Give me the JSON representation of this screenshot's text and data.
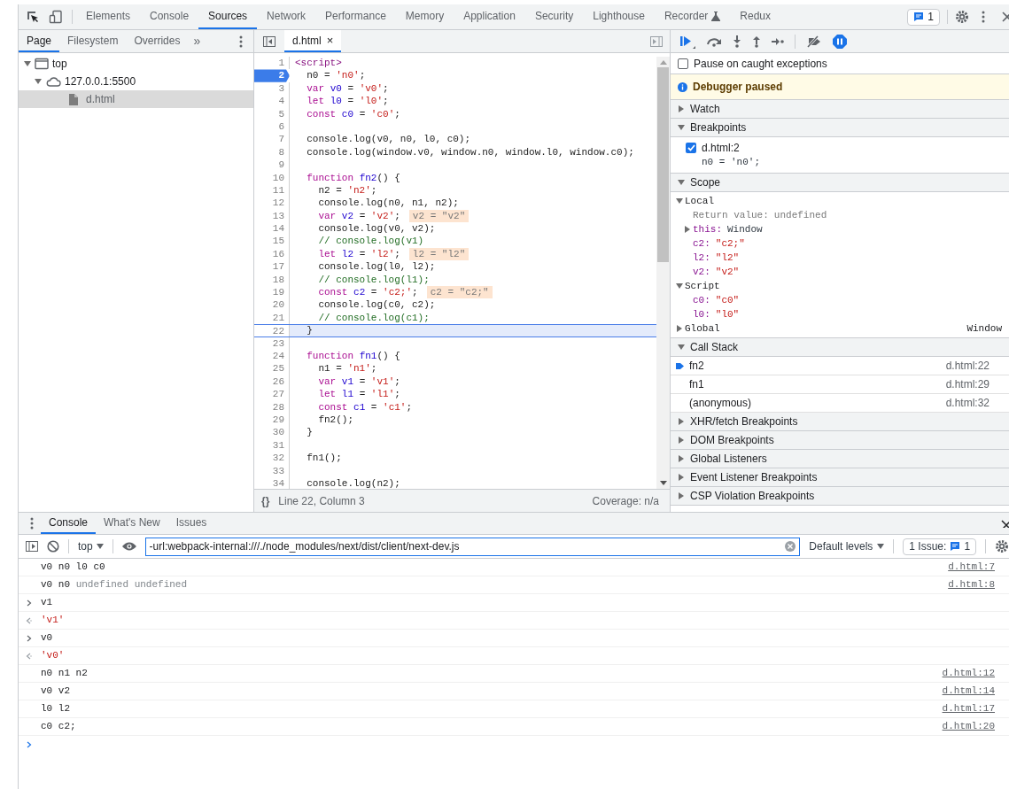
{
  "main_tabs": [
    {
      "label": "Elements",
      "selected": false
    },
    {
      "label": "Console",
      "selected": false
    },
    {
      "label": "Sources",
      "selected": true
    },
    {
      "label": "Network",
      "selected": false
    },
    {
      "label": "Performance",
      "selected": false
    },
    {
      "label": "Memory",
      "selected": false
    },
    {
      "label": "Application",
      "selected": false
    },
    {
      "label": "Security",
      "selected": false
    },
    {
      "label": "Lighthouse",
      "selected": false
    },
    {
      "label": "Recorder",
      "selected": false,
      "experimental": true
    },
    {
      "label": "Redux",
      "selected": false
    }
  ],
  "issues_badge": "1",
  "navigator": {
    "tabs": [
      {
        "label": "Page",
        "selected": true
      },
      {
        "label": "Filesystem",
        "selected": false
      },
      {
        "label": "Overrides",
        "selected": false
      }
    ],
    "more": "»",
    "tree": [
      {
        "label": "top",
        "kind": "frame",
        "expanded": true,
        "selected": false,
        "children": [
          {
            "label": "127.0.0.1:5500",
            "kind": "origin",
            "expanded": true,
            "selected": false,
            "children": [
              {
                "label": "d.html",
                "kind": "file",
                "selected": true
              }
            ]
          }
        ]
      }
    ]
  },
  "editor": {
    "tab": "d.html",
    "close": "×",
    "status": "Line 22, Column 3",
    "coverage": "Coverage: n/a",
    "pretty": "{}",
    "lines": [
      {
        "number": "1",
        "code": "<script>",
        "breakpoint": false,
        "paused": false
      },
      {
        "number": "2",
        "code": "  n0 = 'n0';",
        "breakpoint": true,
        "paused": false
      },
      {
        "number": "3",
        "code": "  var v0 = 'v0';",
        "breakpoint": false,
        "paused": false
      },
      {
        "number": "4",
        "code": "  let l0 = 'l0';",
        "breakpoint": false,
        "paused": false
      },
      {
        "number": "5",
        "code": "  const c0 = 'c0';",
        "breakpoint": false,
        "paused": false
      },
      {
        "number": "6",
        "breakpoint": false,
        "paused": false
      },
      {
        "number": "7",
        "code": "  console.log(v0, n0, l0, c0);",
        "breakpoint": false,
        "paused": false
      },
      {
        "number": "8",
        "code": "  console.log(window.v0, window.n0, window.l0, window.c0);",
        "breakpoint": false,
        "paused": false
      },
      {
        "number": "9",
        "breakpoint": false,
        "paused": false
      },
      {
        "number": "10",
        "code": "  function fn2() {",
        "breakpoint": false,
        "paused": false
      },
      {
        "number": "11",
        "code": "    n2 = 'n2';",
        "breakpoint": false,
        "paused": false
      },
      {
        "number": "12",
        "code": "    console.log(n0, n1, n2);",
        "breakpoint": false,
        "paused": false
      },
      {
        "number": "13",
        "code": "    var v2 = 'v2';",
        "breakpoint": false,
        "paused": false,
        "inline_value": "v2 = \"v2\""
      },
      {
        "number": "14",
        "code": "    console.log(v0, v2);",
        "breakpoint": false,
        "paused": false
      },
      {
        "number": "15",
        "code": "    // console.log(v1)",
        "breakpoint": false,
        "paused": false
      },
      {
        "number": "16",
        "code": "    let l2 = 'l2';",
        "breakpoint": false,
        "paused": false,
        "inline_value": "l2 = \"l2\""
      },
      {
        "number": "17",
        "code": "    console.log(l0, l2);",
        "breakpoint": false,
        "paused": false
      },
      {
        "number": "18",
        "code": "    // console.log(l1);",
        "breakpoint": false,
        "paused": false
      },
      {
        "number": "19",
        "code": "    const c2 = 'c2;';",
        "breakpoint": false,
        "paused": false,
        "inline_value": "c2 = \"c2;\""
      },
      {
        "number": "20",
        "code": "    console.log(c0, c2);",
        "breakpoint": false,
        "paused": false
      },
      {
        "number": "21",
        "code": "    // console.log(c1);",
        "breakpoint": false,
        "paused": false
      },
      {
        "number": "22",
        "code": "  }",
        "breakpoint": false,
        "paused": true
      },
      {
        "number": "23",
        "breakpoint": false,
        "paused": false
      },
      {
        "number": "24",
        "code": "  function fn1() {",
        "breakpoint": false,
        "paused": false
      },
      {
        "number": "25",
        "code": "    n1 = 'n1';",
        "breakpoint": false,
        "paused": false
      },
      {
        "number": "26",
        "code": "    var v1 = 'v1';",
        "breakpoint": false,
        "paused": false
      },
      {
        "number": "27",
        "code": "    let l1 = 'l1';",
        "breakpoint": false,
        "paused": false
      },
      {
        "number": "28",
        "code": "    const c1 = 'c1';",
        "breakpoint": false,
        "paused": false
      },
      {
        "number": "29",
        "code": "    fn2();",
        "breakpoint": false,
        "paused": false
      },
      {
        "number": "30",
        "code": "  }",
        "breakpoint": false,
        "paused": false
      },
      {
        "number": "31",
        "breakpoint": false,
        "paused": false
      },
      {
        "number": "32",
        "code": "  fn1();",
        "breakpoint": false,
        "paused": false
      },
      {
        "number": "33",
        "breakpoint": false,
        "paused": false
      },
      {
        "number": "34",
        "code": "  console.log(n2);",
        "breakpoint": false,
        "paused": false
      }
    ]
  },
  "debugger": {
    "pause_on_caught": {
      "label": "Pause on caught exceptions",
      "checked": false
    },
    "paused_message": "Debugger paused",
    "watch": {
      "title": "Watch",
      "expanded": false
    },
    "breakpoints": {
      "title": "Breakpoints",
      "expanded": true,
      "items": [
        {
          "location": "d.html:2",
          "code": "n0 = 'n0';",
          "checked": true
        }
      ]
    },
    "scope": {
      "title": "Scope",
      "expanded": true,
      "groups": [
        {
          "name": "Local",
          "expanded": true,
          "children": [
            {
              "name": "Return value:",
              "value": "undefined",
              "kind": "special"
            },
            {
              "name": "this:",
              "value": "Window",
              "kind": "object",
              "expanded": false
            },
            {
              "name": "c2:",
              "value": "\"c2;\"",
              "kind": "string"
            },
            {
              "name": "l2:",
              "value": "\"l2\"",
              "kind": "string"
            },
            {
              "name": "v2:",
              "value": "\"v2\"",
              "kind": "string"
            }
          ]
        },
        {
          "name": "Script",
          "expanded": true,
          "children": [
            {
              "name": "c0:",
              "value": "\"c0\"",
              "kind": "string"
            },
            {
              "name": "l0:",
              "value": "\"l0\"",
              "kind": "string"
            }
          ]
        },
        {
          "name": "Global",
          "expanded": false,
          "value": "Window"
        }
      ]
    },
    "call_stack": {
      "title": "Call Stack",
      "expanded": true,
      "frames": [
        {
          "name": "fn2",
          "location": "d.html:22",
          "selected": true
        },
        {
          "name": "fn1",
          "location": "d.html:29",
          "selected": false
        },
        {
          "name": "(anonymous)",
          "location": "d.html:32",
          "selected": false
        }
      ]
    },
    "collapsed_sections": [
      {
        "title": "XHR/fetch Breakpoints",
        "expanded": false
      },
      {
        "title": "DOM Breakpoints",
        "expanded": false
      },
      {
        "title": "Global Listeners",
        "expanded": false
      },
      {
        "title": "Event Listener Breakpoints",
        "expanded": false
      },
      {
        "title": "CSP Violation Breakpoints",
        "expanded": false
      }
    ]
  },
  "drawer": {
    "tabs": [
      {
        "label": "Console",
        "selected": true
      },
      {
        "label": "What's New",
        "selected": false
      },
      {
        "label": "Issues",
        "selected": false
      }
    ],
    "context": "top",
    "filter": "-url:webpack-internal:///./node_modules/next/dist/client/next-dev.js",
    "levels": "Default levels",
    "issues_label": "1 Issue:",
    "issues_count": "1",
    "messages": [
      {
        "kind": "log",
        "text": "v0 n0 l0 c0",
        "source": "d.html:7"
      },
      {
        "kind": "log",
        "text": "v0 n0",
        "muted_text": "undefined undefined",
        "source": "d.html:8"
      },
      {
        "kind": "input",
        "text": "v1"
      },
      {
        "kind": "result",
        "text": "'v1'"
      },
      {
        "kind": "input",
        "text": "v0"
      },
      {
        "kind": "result",
        "text": "'v0'"
      },
      {
        "kind": "log",
        "text": "n0 n1 n2",
        "source": "d.html:12"
      },
      {
        "kind": "log",
        "text": "v0 v2",
        "source": "d.html:14"
      },
      {
        "kind": "log",
        "text": "l0 l2",
        "source": "d.html:17"
      },
      {
        "kind": "log",
        "text": "c0 c2;",
        "source": "d.html:20"
      }
    ]
  }
}
